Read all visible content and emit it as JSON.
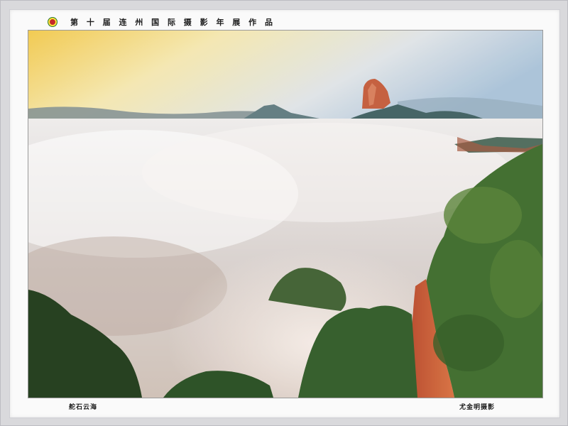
{
  "header": {
    "title": "第 十 届 连 州 国 际 摄 影 年 展 作 品",
    "logo_icon": "festival-logo-icon"
  },
  "photo": {
    "subject": "landscape-photo",
    "caption": "舵石云海",
    "credit": "尤金明摄影"
  },
  "colors": {
    "sky_warm": "#f2c94c",
    "sky_cool": "#a9c2d8",
    "cloud": "#e9e3df",
    "foliage": "#3d6b2a",
    "cliff": "#c2542f"
  }
}
